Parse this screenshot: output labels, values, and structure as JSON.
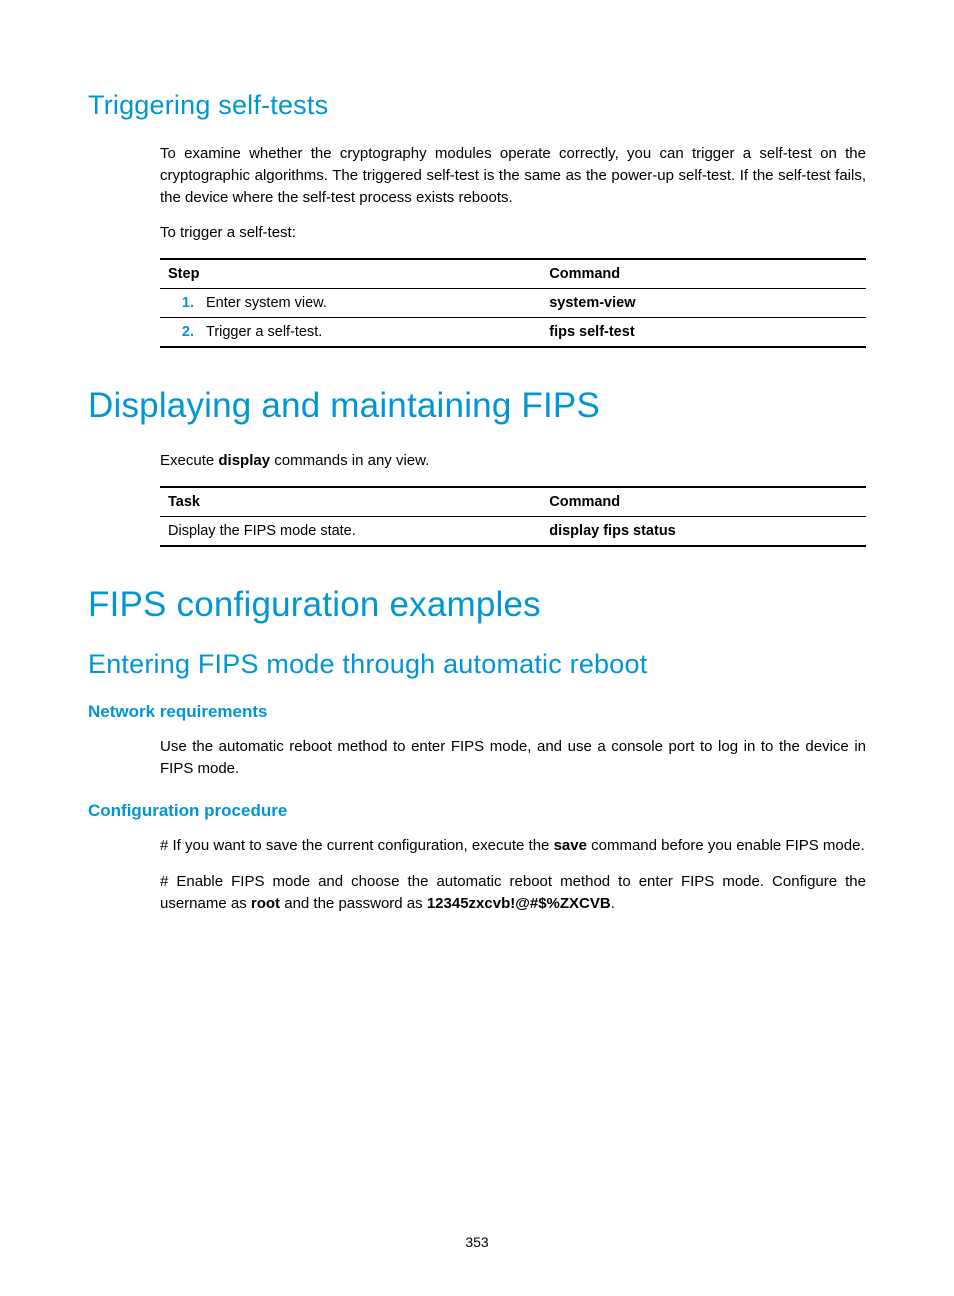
{
  "section_trigger": {
    "heading": "Triggering self-tests",
    "para1": "To examine whether the cryptography modules operate correctly, you can trigger a self-test on the cryptographic algorithms. The triggered self-test is the same as the power-up self-test. If the self-test fails, the device where the self-test process exists reboots.",
    "para2": "To trigger a self-test:",
    "table": {
      "headers": {
        "step": "Step",
        "command": "Command"
      },
      "rows": [
        {
          "num": "1.",
          "step": "Enter system view.",
          "command": "system-view"
        },
        {
          "num": "2.",
          "step": "Trigger a self-test.",
          "command": "fips self-test"
        }
      ]
    }
  },
  "section_display": {
    "heading": "Displaying and maintaining FIPS",
    "para_prefix": "Execute ",
    "para_bold": "display",
    "para_suffix": " commands in any view.",
    "table": {
      "headers": {
        "task": "Task",
        "command": "Command"
      },
      "rows": [
        {
          "task": "Display the FIPS mode state.",
          "command": "display fips status"
        }
      ]
    }
  },
  "section_examples": {
    "heading": "FIPS configuration examples",
    "subheading": "Entering FIPS mode through automatic reboot",
    "netreq": {
      "heading": "Network requirements",
      "para": "Use the automatic reboot method to enter FIPS mode, and use a console port to log in to the device in FIPS mode."
    },
    "config": {
      "heading": "Configuration procedure",
      "para1_a": "# If you want to save the current configuration, execute the ",
      "para1_b": "save",
      "para1_c": " command before you enable FIPS mode.",
      "para2_a": "# Enable FIPS mode and choose the automatic reboot method to enter FIPS mode. Configure the username as ",
      "para2_b": "root",
      "para2_c": " and the password as ",
      "para2_d": "12345zxcvb!@#$%ZXCVB",
      "para2_e": "."
    }
  },
  "page_number": "353"
}
